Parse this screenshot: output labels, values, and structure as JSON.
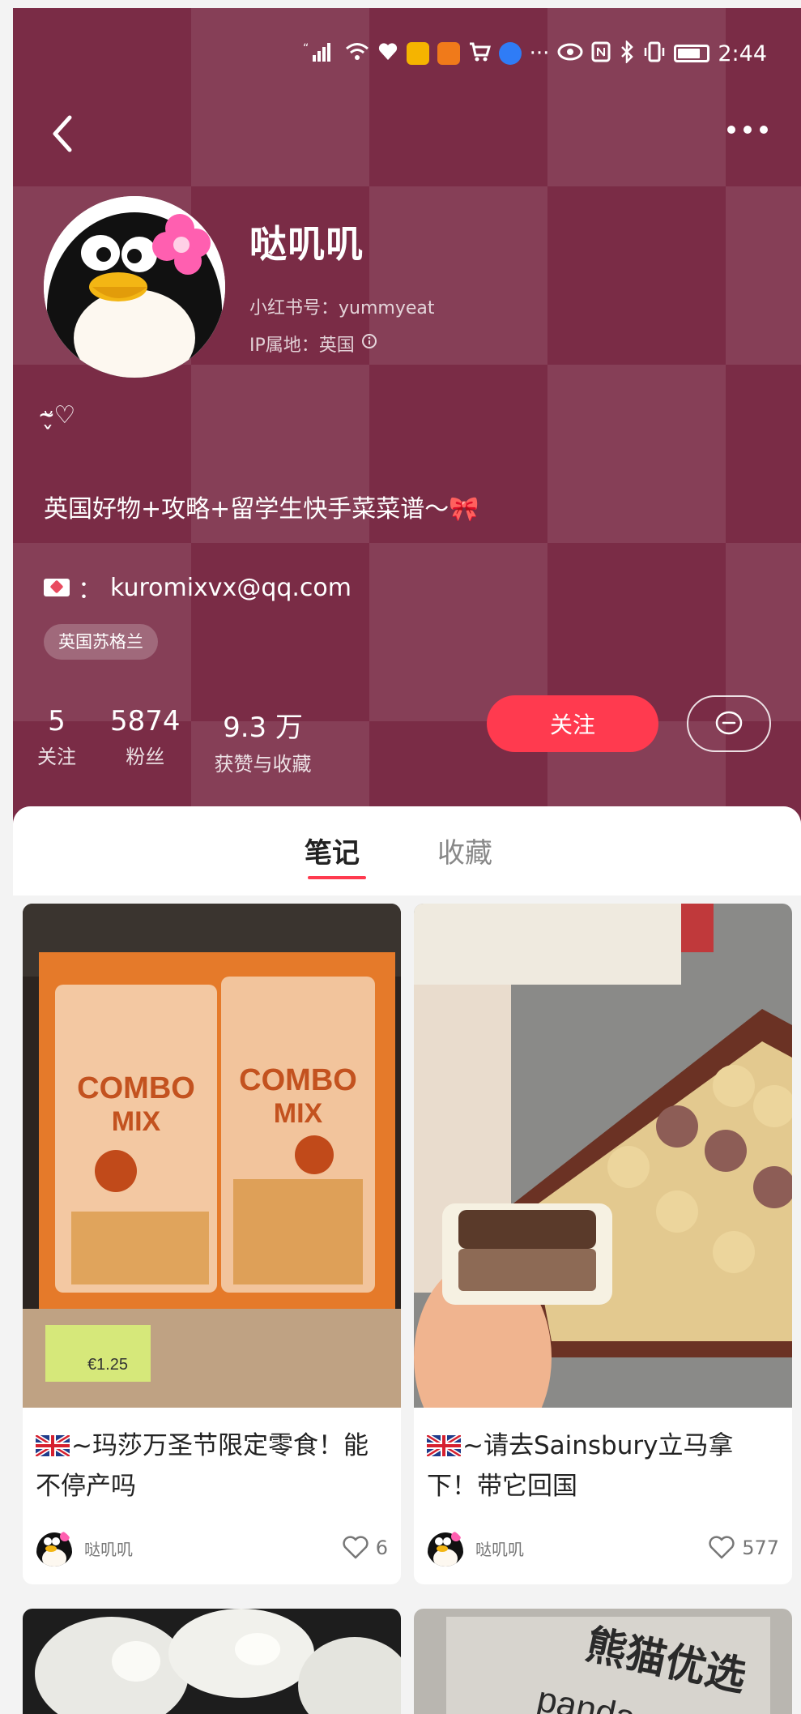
{
  "status_bar": {
    "signal_text": "“‖",
    "time": "2:44",
    "icons": [
      "signal-icon",
      "wifi-icon",
      "heart-app-icon",
      "mail-app-icon",
      "camera-app-icon",
      "cart-app-icon",
      "browser-app-icon",
      "more-dots",
      "eye-icon",
      "nfc-icon",
      "bluetooth-icon",
      "vibrate-icon",
      "battery-icon"
    ],
    "ellipsis": "···"
  },
  "profile": {
    "nickname": "哒叽叽",
    "redbook_id": "小红书号：yummyeat",
    "ip_location": "IP属地：英国",
    "emoticon": "ᵕ̴̬♡",
    "bio": "英国好物+攻略+留学生快手菜菜谱～🎀",
    "email_sep": "：",
    "email": "kuromixvx@qq.com",
    "location_tag": "英国苏格兰"
  },
  "stats": [
    {
      "value": "5",
      "label": "关注"
    },
    {
      "value": "5874",
      "label": "粉丝"
    },
    {
      "value": "9.3 万",
      "label": "获赞与收藏"
    }
  ],
  "actions": {
    "follow_label": "关注"
  },
  "tabs": [
    {
      "label": "笔记",
      "active": true
    },
    {
      "label": "收藏",
      "active": false
    }
  ],
  "notes": [
    {
      "title": "~玛莎万圣节限定零食！能不停产吗",
      "author": "哒叽叽",
      "likes": "6",
      "price_tag": "€1.25"
    },
    {
      "title": "~请去Sainsbury立马拿下！带它回国",
      "author": "哒叽叽",
      "likes": "577"
    }
  ],
  "lower_cards": {
    "panda_text_cn": "熊猫优选",
    "panda_text_en": "panda"
  },
  "colors": {
    "header_bg": "#7a2c46",
    "accent": "#ff3a4f"
  }
}
